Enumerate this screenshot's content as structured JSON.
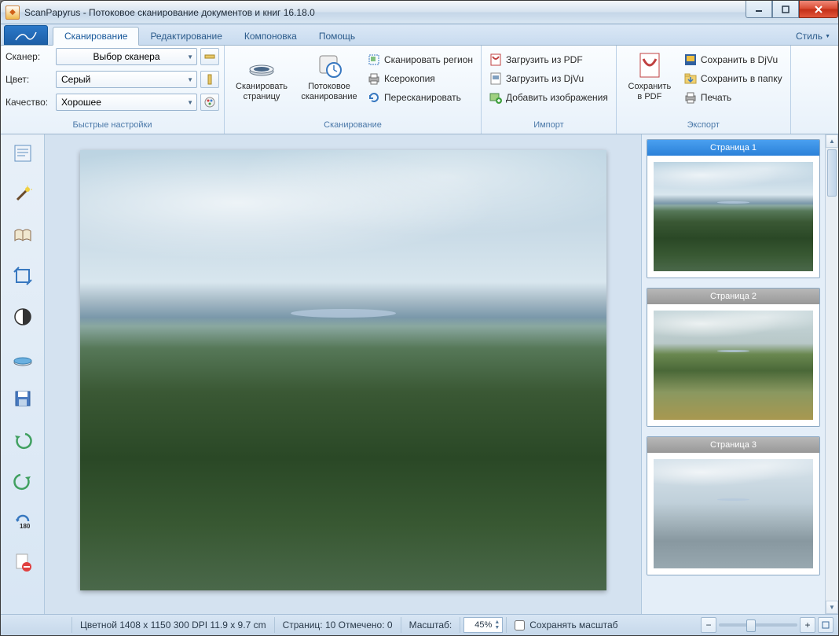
{
  "window": {
    "title": "ScanPapyrus - Потоковое сканирование документов и книг 16.18.0"
  },
  "tabs": {
    "scan": "Сканирование",
    "edit": "Редактирование",
    "layout": "Компоновка",
    "help": "Помощь",
    "style": "Стиль"
  },
  "settings": {
    "scanner_label": "Сканер:",
    "scanner_value": "Выбор сканера",
    "color_label": "Цвет:",
    "color_value": "Серый",
    "quality_label": "Качество:",
    "quality_value": "Хорошее",
    "group": "Быстрые настройки"
  },
  "scan_group": {
    "scan_page_l1": "Сканировать",
    "scan_page_l2": "страницу",
    "batch_l1": "Потоковое",
    "batch_l2": "сканирование",
    "region": "Сканировать регион",
    "copy": "Ксерокопия",
    "rescan": "Пересканировать",
    "group": "Сканирование"
  },
  "import_group": {
    "pdf": "Загрузить из PDF",
    "djvu": "Загрузить из DjVu",
    "images": "Добавить изображения",
    "group": "Импорт"
  },
  "export_group": {
    "save_pdf_l1": "Сохранить",
    "save_pdf_l2": "в PDF",
    "save_djvu": "Сохранить в DjVu",
    "save_folder": "Сохранить в папку",
    "print": "Печать",
    "group": "Экспорт"
  },
  "pages": {
    "p1": "Страница 1",
    "p2": "Страница 2",
    "p3": "Страница 3"
  },
  "status": {
    "info": "Цветной  1408 x 1150  300 DPI  11.9 x 9.7 cm",
    "pages": "Страниц: 10 Отмечено: 0",
    "zoom_label": "Масштаб:",
    "zoom_value": "45%",
    "keep_zoom": "Сохранять масштаб"
  }
}
